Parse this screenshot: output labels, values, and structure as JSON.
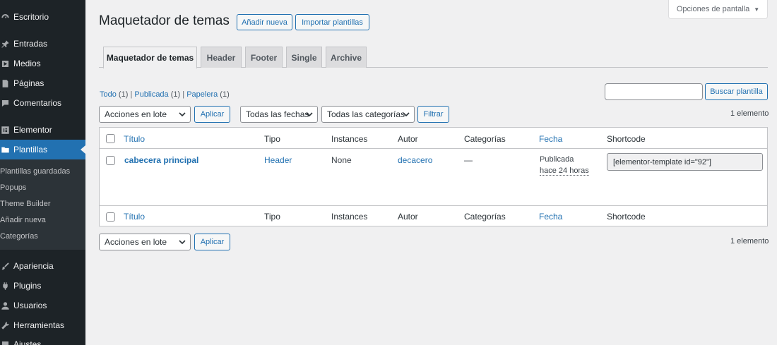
{
  "sidebar": {
    "items": [
      {
        "label": "Escritorio",
        "icon": "dashboard-icon"
      },
      {
        "label": "Entradas",
        "icon": "pin-icon"
      },
      {
        "label": "Medios",
        "icon": "media-icon"
      },
      {
        "label": "Páginas",
        "icon": "page-icon"
      },
      {
        "label": "Comentarios",
        "icon": "comment-icon"
      },
      {
        "label": "Elementor",
        "icon": "elementor-icon"
      },
      {
        "label": "Plantillas",
        "icon": "folder-icon"
      },
      {
        "label": "Apariencia",
        "icon": "brush-icon"
      },
      {
        "label": "Plugins",
        "icon": "plugin-icon"
      },
      {
        "label": "Usuarios",
        "icon": "user-icon"
      },
      {
        "label": "Herramientas",
        "icon": "wrench-icon"
      },
      {
        "label": "Ajustes",
        "icon": "settings-icon"
      }
    ],
    "submenu": [
      "Plantillas guardadas",
      "Popups",
      "Theme Builder",
      "Añadir nueva",
      "Categorías"
    ]
  },
  "screen_options": {
    "label": "Opciones de pantalla"
  },
  "page": {
    "title": "Maquetador de temas",
    "add_new": "Añadir nueva",
    "import": "Importar plantillas"
  },
  "tabs": [
    "Maquetador de temas",
    "Header",
    "Footer",
    "Single",
    "Archive"
  ],
  "filters": {
    "all_label": "Todo",
    "all_count": "(1)",
    "published_label": "Publicada",
    "published_count": "(1)",
    "trash_label": "Papelera",
    "trash_count": "(1)",
    "separator": "|"
  },
  "search": {
    "button": "Buscar plantilla",
    "value": ""
  },
  "toolbar": {
    "bulk_actions": "Acciones en lote",
    "apply": "Aplicar",
    "dates": "Todas las fechas",
    "categories": "Todas las categorías",
    "filter": "Filtrar",
    "items_count": "1 elemento"
  },
  "table": {
    "columns": {
      "title": "Título",
      "type": "Tipo",
      "instances": "Instances",
      "author": "Autor",
      "categories": "Categorías",
      "date": "Fecha",
      "shortcode": "Shortcode"
    },
    "rows": [
      {
        "title": "cabecera principal",
        "type": "Header",
        "instances": "None",
        "author": "decacero",
        "categories": "—",
        "status": "Publicada",
        "date": "hace 24 horas",
        "shortcode": "[elementor-template id=\"92\"]"
      }
    ]
  },
  "colors": {
    "accent": "#2271b1",
    "sidebar_bg": "#1d2327",
    "submenu_bg": "#2c3338",
    "page_bg": "#f0f0f1"
  }
}
